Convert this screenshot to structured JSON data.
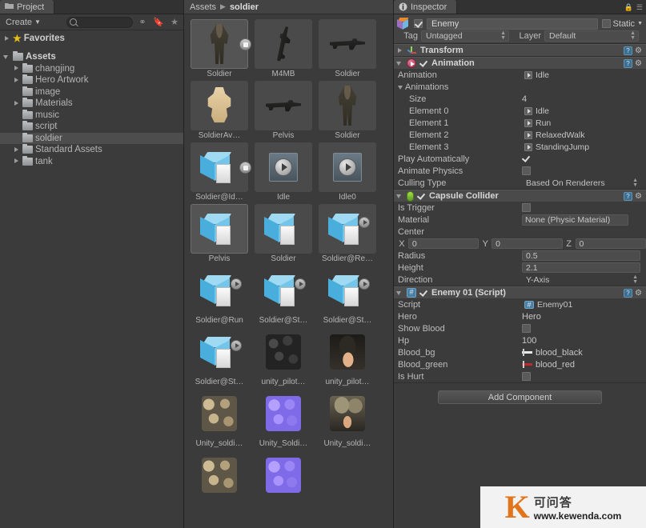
{
  "project_panel": {
    "tab_label": "Project",
    "tab_icon": "folder-icon",
    "create_label": "Create",
    "search_placeholder": "",
    "search_value": "",
    "toolbar_icons": [
      "filter-by-type-icon",
      "filter-by-label-icon",
      "favorite-star-icon"
    ],
    "favorites_label": "Favorites",
    "tree": [
      {
        "label": "Assets",
        "indent": 0,
        "arrow": "open",
        "selected": false,
        "bold": true
      },
      {
        "label": "changjing",
        "indent": 1,
        "arrow": "closed",
        "selected": false,
        "bold": false
      },
      {
        "label": "Hero Artwork",
        "indent": 1,
        "arrow": "closed",
        "selected": false,
        "bold": false
      },
      {
        "label": "image",
        "indent": 1,
        "arrow": "none",
        "selected": false,
        "bold": false
      },
      {
        "label": "Materials",
        "indent": 1,
        "arrow": "closed",
        "selected": false,
        "bold": false
      },
      {
        "label": "music",
        "indent": 1,
        "arrow": "none",
        "selected": false,
        "bold": false
      },
      {
        "label": "script",
        "indent": 1,
        "arrow": "none",
        "selected": false,
        "bold": false
      },
      {
        "label": "soldier",
        "indent": 1,
        "arrow": "none",
        "selected": true,
        "bold": false
      },
      {
        "label": "Standard Assets",
        "indent": 1,
        "arrow": "closed",
        "selected": false,
        "bold": false
      },
      {
        "label": "tank",
        "indent": 1,
        "arrow": "closed",
        "selected": false,
        "bold": false
      }
    ]
  },
  "assets_panel": {
    "breadcrumb_root": "Assets",
    "breadcrumb_current": "soldier",
    "rows": [
      {
        "group": true,
        "items": [
          {
            "label": "Soldier",
            "kind": "soldier-silhouette",
            "selected": true,
            "badge": "model-badge"
          },
          {
            "label": "M4MB",
            "kind": "rifle-vertical",
            "selected": false,
            "badge": "none"
          },
          {
            "label": "Soldier",
            "kind": "rifle-horizontal",
            "selected": false,
            "badge": "none"
          }
        ]
      },
      {
        "group": true,
        "items": [
          {
            "label": "SoldierAv…",
            "kind": "avatar",
            "selected": false,
            "badge": "none"
          },
          {
            "label": "Pelvis",
            "kind": "rifle-horizontal",
            "selected": false,
            "badge": "none"
          },
          {
            "label": "Soldier",
            "kind": "soldier-silhouette",
            "selected": false,
            "badge": "none"
          }
        ]
      },
      {
        "group": true,
        "items": [
          {
            "label": "Soldier@Id…",
            "kind": "cube",
            "selected": false,
            "badge": "model-badge"
          },
          {
            "label": "Idle",
            "kind": "anim-clip",
            "selected": false,
            "badge": "none"
          },
          {
            "label": "Idle0",
            "kind": "anim-clip",
            "selected": false,
            "badge": "none"
          }
        ]
      },
      {
        "group": true,
        "items": [
          {
            "label": "Pelvis",
            "kind": "cube",
            "selected": true,
            "badge": "none"
          },
          {
            "label": "Soldier",
            "kind": "cube",
            "selected": false,
            "badge": "none"
          },
          {
            "label": "Soldier@Re…",
            "kind": "cube",
            "selected": false,
            "badge": "play-badge"
          }
        ]
      },
      {
        "group": false,
        "items": [
          {
            "label": "Soldier@Run",
            "kind": "cube",
            "selected": false,
            "badge": "play-badge"
          },
          {
            "label": "Soldier@St…",
            "kind": "cube",
            "selected": false,
            "badge": "play-badge"
          },
          {
            "label": "Soldier@St…",
            "kind": "cube",
            "selected": false,
            "badge": "play-badge"
          }
        ]
      },
      {
        "group": false,
        "items": [
          {
            "label": "Soldier@St…",
            "kind": "cube",
            "selected": false,
            "badge": "play-badge"
          },
          {
            "label": "unity_pilot…",
            "kind": "tex-dark",
            "selected": false,
            "badge": "none"
          },
          {
            "label": "unity_pilot…",
            "kind": "tex-face",
            "selected": false,
            "badge": "none"
          }
        ]
      },
      {
        "group": false,
        "items": [
          {
            "label": "Unity_soldi…",
            "kind": "tex-tan",
            "selected": false,
            "badge": "none"
          },
          {
            "label": "Unity_Soldi…",
            "kind": "tex-normal",
            "selected": false,
            "badge": "none"
          },
          {
            "label": "Unity_soldi…",
            "kind": "tex-helmet",
            "selected": false,
            "badge": "none"
          }
        ]
      },
      {
        "group": false,
        "items": [
          {
            "label": "",
            "kind": "tex-tan",
            "selected": false,
            "badge": "none"
          },
          {
            "label": "",
            "kind": "tex-normal",
            "selected": false,
            "badge": "none"
          },
          {
            "label": "",
            "kind": "none",
            "selected": false,
            "badge": "none"
          }
        ]
      }
    ]
  },
  "inspector": {
    "tab_label": "Inspector",
    "tab_icon": "info-icon",
    "lock_icon": "lock-icon",
    "menu_icon": "hamburger-menu-icon",
    "game_object": {
      "name": "Enemy",
      "enabled": true,
      "static_label": "Static",
      "static_checked": false,
      "tag_label": "Tag",
      "tag_value": "Untagged",
      "layer_label": "Layer",
      "layer_value": "Default"
    },
    "components": [
      {
        "title": "Transform",
        "icon": "transform-icon",
        "expanded": false,
        "has_checkbox": false,
        "enabled": false,
        "rows": []
      },
      {
        "title": "Animation",
        "icon": "animation-icon",
        "expanded": true,
        "has_checkbox": true,
        "enabled": true,
        "rows": [
          {
            "type": "object",
            "label": "Animation",
            "value": "Idle",
            "indent": 0
          },
          {
            "type": "foldout",
            "label": "Animations",
            "value": "",
            "indent": 0
          },
          {
            "type": "text",
            "label": "Size",
            "value": "4",
            "indent": 1
          },
          {
            "type": "object",
            "label": "Element 0",
            "value": "Idle",
            "indent": 1
          },
          {
            "type": "object",
            "label": "Element 1",
            "value": "Run",
            "indent": 1
          },
          {
            "type": "object",
            "label": "Element 2",
            "value": "RelaxedWalk",
            "indent": 1
          },
          {
            "type": "object",
            "label": "Element 3",
            "value": "StandingJump",
            "indent": 1
          },
          {
            "type": "checkbox",
            "label": "Play Automatically",
            "value": "true",
            "indent": 0
          },
          {
            "type": "checkbox",
            "label": "Animate Physics",
            "value": "false",
            "indent": 0
          },
          {
            "type": "enum",
            "label": "Culling Type",
            "value": "Based On Renderers",
            "indent": 0
          }
        ]
      },
      {
        "title": "Capsule Collider",
        "icon": "capsule-collider-icon",
        "expanded": true,
        "has_checkbox": true,
        "enabled": true,
        "rows": [
          {
            "type": "checkbox",
            "label": "Is Trigger",
            "value": "false",
            "indent": 0
          },
          {
            "type": "objbox",
            "label": "Material",
            "value": "None (Physic Material)",
            "indent": 0
          },
          {
            "type": "plain",
            "label": "Center",
            "value": "",
            "indent": 0
          },
          {
            "type": "vector3",
            "label": "",
            "value": "",
            "indent": 0,
            "axes": [
              {
                "axis": "X",
                "value": "0"
              },
              {
                "axis": "Y",
                "value": "0"
              },
              {
                "axis": "Z",
                "value": "0"
              }
            ]
          },
          {
            "type": "number",
            "label": "Radius",
            "value": "0.5",
            "indent": 0
          },
          {
            "type": "number",
            "label": "Height",
            "value": "2.1",
            "indent": 0
          },
          {
            "type": "enum",
            "label": "Direction",
            "value": "Y-Axis",
            "indent": 0
          }
        ]
      },
      {
        "title": "Enemy 01 (Script)",
        "icon": "script-icon",
        "expanded": true,
        "has_checkbox": true,
        "enabled": true,
        "rows": [
          {
            "type": "script",
            "label": "Script",
            "value": "Enemy01",
            "indent": 0
          },
          {
            "type": "objplain",
            "label": "Hero",
            "value": "Hero",
            "indent": 0
          },
          {
            "type": "checkbox",
            "label": "Show Blood",
            "value": "false",
            "indent": 0
          },
          {
            "type": "text",
            "label": "Hp",
            "value": "100",
            "indent": 0
          },
          {
            "type": "sprite",
            "label": "Blood_bg",
            "value": "blood_black",
            "indent": 0,
            "color": "#e8e8e8"
          },
          {
            "type": "sprite",
            "label": "Blood_green",
            "value": "blood_red",
            "indent": 0,
            "color": "#c2282f"
          },
          {
            "type": "checkbox",
            "label": "Is Hurt",
            "value": "false",
            "indent": 0
          }
        ]
      }
    ],
    "add_component_label": "Add Component"
  },
  "watermark": {
    "logo_letter": "K",
    "chinese": "可问答",
    "url": "www.kewenda.com",
    "accent_color": "#e2751c"
  }
}
